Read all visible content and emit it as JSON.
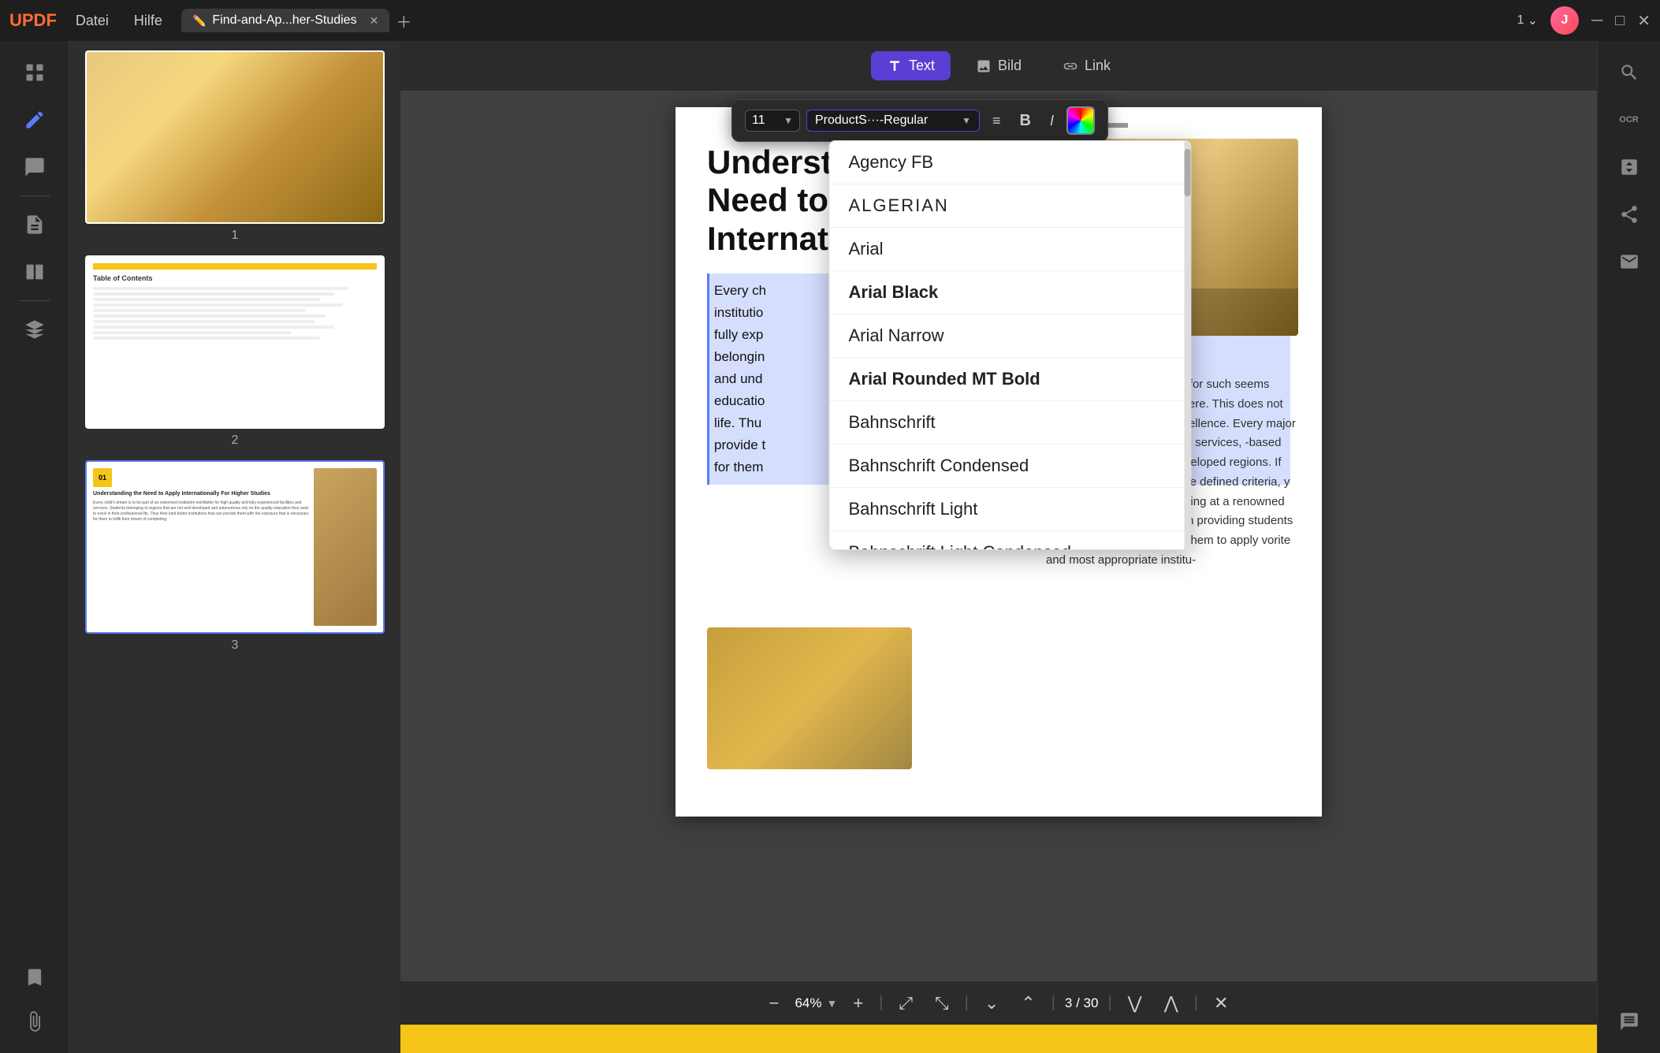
{
  "app": {
    "logo": "UPDF",
    "menus": [
      "Datei",
      "Hilfe"
    ],
    "tab": {
      "label": "Find-and-Ap...her-Studies",
      "icon": "✏️"
    },
    "page_indicator": "1",
    "user_initial": "J"
  },
  "toolbar": {
    "text_label": "Text",
    "bild_label": "Bild",
    "link_label": "Link"
  },
  "font_toolbar": {
    "size": "11",
    "font_name": "ProductS···-Regular",
    "bold_label": "B",
    "italic_label": "I"
  },
  "font_list": [
    {
      "name": "Agency FB",
      "style": "normal"
    },
    {
      "name": "ALGERIAN",
      "style": "algerian"
    },
    {
      "name": "Arial",
      "style": "normal"
    },
    {
      "name": "Arial Black",
      "style": "arial-black"
    },
    {
      "name": "Arial Narrow",
      "style": "narrow"
    },
    {
      "name": "Arial Rounded MT Bold",
      "style": "arial-rounded"
    },
    {
      "name": "Bahnschrift",
      "style": "normal"
    },
    {
      "name": "Bahnschrift Condensed",
      "style": "condensed"
    },
    {
      "name": "Bahnschrift Light",
      "style": "light"
    },
    {
      "name": "Bahnschrift Light Condensed",
      "style": "light-condensed"
    }
  ],
  "pdf": {
    "page_title": "Understanding the Need to Apply Internationally For",
    "selected_text_lines": [
      "Every ch",
      "institutio",
      "fully exp",
      "belongin",
      "and und",
      "educatio",
      "life. Thu",
      "provide t",
      "for them"
    ],
    "body_text_right": "to fulfilling the student fees for such seems impossible to even think of ere. This does not mean an end to a ey to excellence. Every major insti- he world, known for its services, -based scholarships to applicants veloped regions. If the specific gible through the defined criteria, y fulfill their dream of completing at a renowned institute. This docu- ased on providing students with a an essentially guide them to apply vorite and most appropriate institu-"
  },
  "thumbnails": [
    {
      "label": "1"
    },
    {
      "label": "2"
    },
    {
      "label": "3"
    }
  ],
  "bottom_toolbar": {
    "zoom_out": "−",
    "zoom_value": "64%",
    "zoom_in": "+",
    "page_current": "3",
    "page_total": "30",
    "close": "✕"
  },
  "sidebar_icons": {
    "thumbnails": "☰",
    "edit": "✏",
    "comments": "💬",
    "pages": "📄",
    "ocr": "OCR",
    "convert": "↔",
    "share": "↑",
    "stamp": "⬜",
    "layers": "▦",
    "bookmarks": "🔖",
    "attachments": "📎",
    "chat": "💭"
  },
  "right_sidebar_icons": {
    "search": "🔍",
    "ocr": "OCR",
    "convert2": "↔",
    "share2": "↑",
    "mail": "✉",
    "chat2": "💭"
  }
}
